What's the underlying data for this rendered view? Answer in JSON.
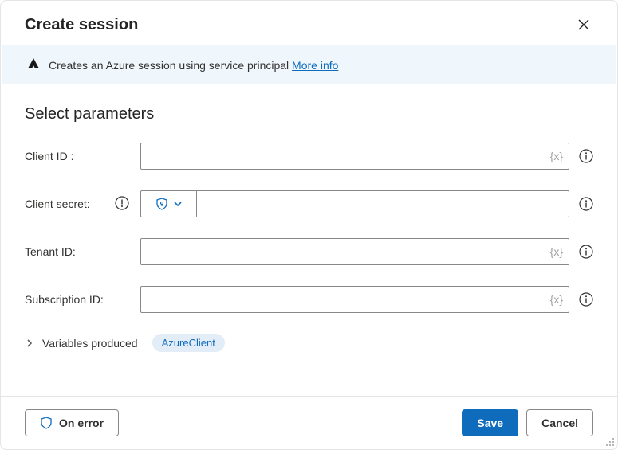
{
  "header": {
    "title": "Create session"
  },
  "banner": {
    "text": "Creates an Azure session using service principal",
    "more_info": "More info"
  },
  "section": {
    "title": "Select parameters"
  },
  "fields": {
    "client_id": {
      "label": "Client ID :",
      "value": "",
      "var_hint": "{x}"
    },
    "client_secret": {
      "label": "Client secret:",
      "value": ""
    },
    "tenant_id": {
      "label": "Tenant ID:",
      "value": "",
      "var_hint": "{x}"
    },
    "subscription_id": {
      "label": "Subscription ID:",
      "value": "",
      "var_hint": "{x}"
    }
  },
  "variables": {
    "label": "Variables produced",
    "pill": "AzureClient"
  },
  "footer": {
    "on_error": "On error",
    "save": "Save",
    "cancel": "Cancel"
  }
}
